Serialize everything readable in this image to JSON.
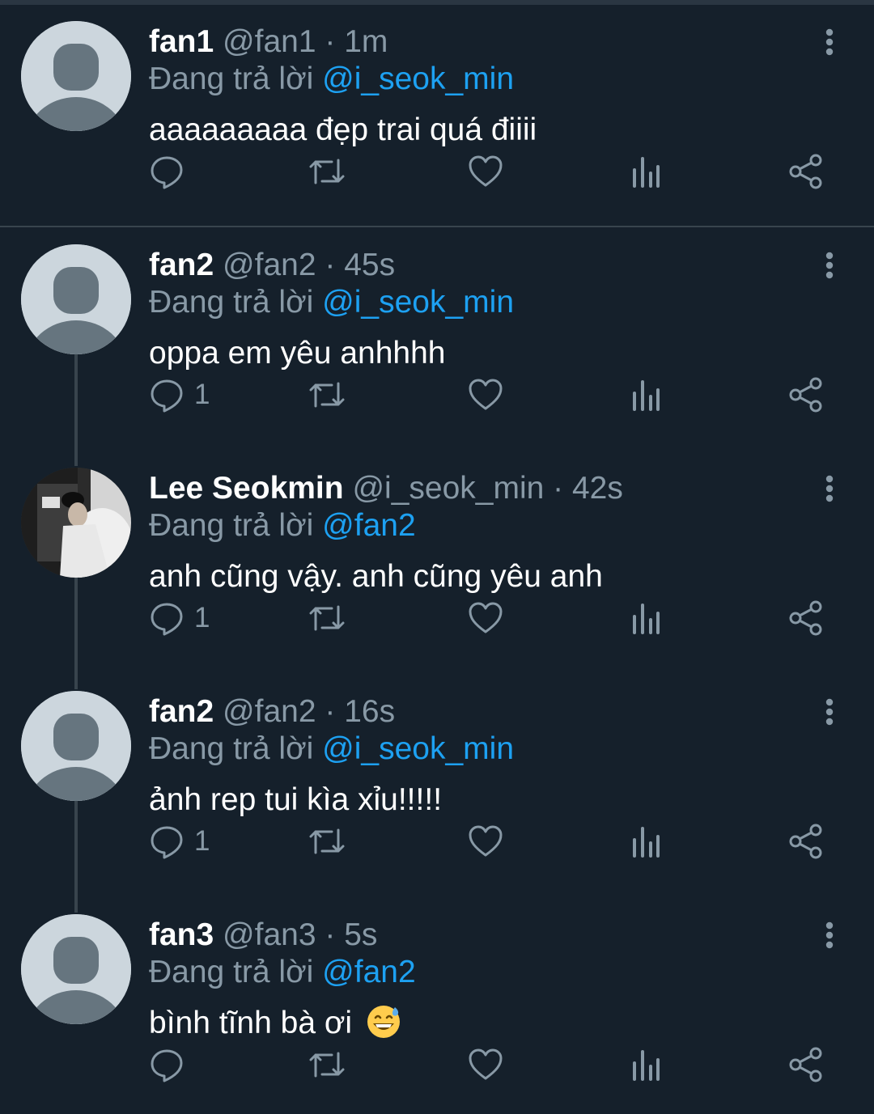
{
  "reply_prefix": "Đang trả lời",
  "tweets": [
    {
      "name": "fan1",
      "handle": "@fan1",
      "dot": "·",
      "time": "1m",
      "replying_to": "@i_seok_min",
      "text": "aaaaaaaaa đẹp trai quá điiii",
      "reply_count": "",
      "avatar": "default-avatar"
    },
    {
      "name": "fan2",
      "handle": "@fan2",
      "dot": "·",
      "time": "45s",
      "replying_to": "@i_seok_min",
      "text": "oppa em yêu anhhhh",
      "reply_count": "1",
      "avatar": "default-avatar"
    },
    {
      "name": "Lee Seokmin",
      "handle": "@i_seok_min",
      "dot": "·",
      "time": "42s",
      "replying_to": "@fan2",
      "text": "anh cũng vậy. anh cũng yêu anh",
      "reply_count": "1",
      "avatar": "profile-photo"
    },
    {
      "name": "fan2",
      "handle": "@fan2",
      "dot": "·",
      "time": "16s",
      "replying_to": "@i_seok_min",
      "text": "ảnh rep tui kìa xỉu!!!!!",
      "reply_count": "1",
      "avatar": "default-avatar"
    },
    {
      "name": "fan3",
      "handle": "@fan3",
      "dot": "·",
      "time": "5s",
      "replying_to": "@fan2",
      "text": "bình tĩnh bà ơi",
      "reply_count": "",
      "avatar": "default-avatar",
      "emoji": "grinning-sweat-emoji"
    }
  ],
  "colors": {
    "background": "#15202b",
    "text": "#ffffff",
    "muted": "#8899a6",
    "mention": "#1da1f2",
    "divider": "#38444d"
  }
}
